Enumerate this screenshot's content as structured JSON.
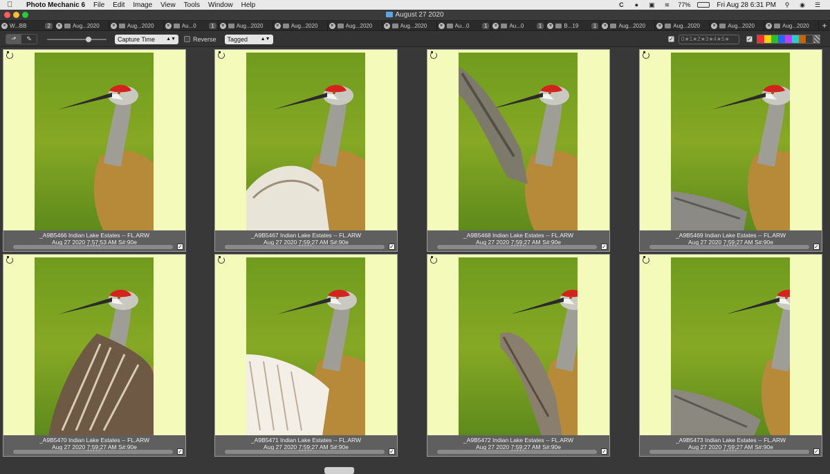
{
  "menubar": {
    "apple": "",
    "app_name": "Photo Mechanic 6",
    "items": [
      "File",
      "Edit",
      "Image",
      "View",
      "Tools",
      "Window",
      "Help"
    ],
    "battery": "77%",
    "clock": "Fri Aug 28  6:31 PM"
  },
  "window": {
    "title": "August 27 2020"
  },
  "tabs": [
    {
      "label": "W...BB",
      "count": "2"
    },
    {
      "label": "Aug...2020",
      "count": ""
    },
    {
      "label": "Aug...2020",
      "count": ""
    },
    {
      "label": "Au...0",
      "count": "1"
    },
    {
      "label": "Aug...2020",
      "count": ""
    },
    {
      "label": "Aug...2020",
      "count": ""
    },
    {
      "label": "Aug...2020",
      "count": ""
    },
    {
      "label": "Aug...2020",
      "count": ""
    },
    {
      "label": "Au...0",
      "count": "1"
    },
    {
      "label": "Au...0",
      "count": "1"
    },
    {
      "label": "B...19",
      "count": "1"
    },
    {
      "label": "Aug...2020",
      "count": ""
    },
    {
      "label": "Aug...2020",
      "count": ""
    },
    {
      "label": "Aug...2020",
      "count": ""
    },
    {
      "label": "Aug...2020",
      "count": ""
    }
  ],
  "toolbar": {
    "sort_select": "Capture Time",
    "reverse_label": "Reverse",
    "filter_select": "Tagged",
    "rating_text": "0★1★2★3★4★5★",
    "size_slider_fraction": 0.72,
    "color_classes": [
      "#ff2d2d",
      "#ffd400",
      "#22c32b",
      "#2a64ff",
      "#c33cff",
      "#1fd1d1",
      "#c86400",
      "#3b3b3b"
    ]
  },
  "photos": [
    {
      "name": "_A9B5466 Indian Lake Estates -- FL.ARW",
      "date": "Aug 27 2020 7:57:53 AM S#:90e",
      "tagged": "✓"
    },
    {
      "name": "_A9B5467 Indian Lake Estates -- FL.ARW",
      "date": "Aug 27 2020 7:59:27 AM S#:90e",
      "tagged": "✓"
    },
    {
      "name": "_A9B5468 Indian Lake Estates -- FL.ARW",
      "date": "Aug 27 2020 7:59:27 AM S#:90e",
      "tagged": "✓"
    },
    {
      "name": "_A9B5469 Indian Lake Estates -- FL.ARW",
      "date": "Aug 27 2020 7:59:27 AM S#:90e",
      "tagged": "✓"
    },
    {
      "name": "_A9B5470 Indian Lake Estates -- FL.ARW",
      "date": "Aug 27 2020 7:59:27 AM S#:90e",
      "tagged": "✓"
    },
    {
      "name": "_A9B5471 Indian Lake Estates -- FL.ARW",
      "date": "Aug 27 2020 7:59:27 AM S#:90e",
      "tagged": "✓"
    },
    {
      "name": "_A9B5472 Indian Lake Estates -- FL.ARW",
      "date": "Aug 27 2020 7:59:27 AM S#:90e",
      "tagged": "✓"
    },
    {
      "name": "_A9B5473 Indian Lake Estates -- FL.ARW",
      "date": "Aug 27 2020 7:59:27 AM S#:90e",
      "tagged": "✓"
    }
  ],
  "colors": {
    "cell_bg": "#f4fab9",
    "caption_bg": "#5f5f5f",
    "grid_bg": "#383838"
  }
}
